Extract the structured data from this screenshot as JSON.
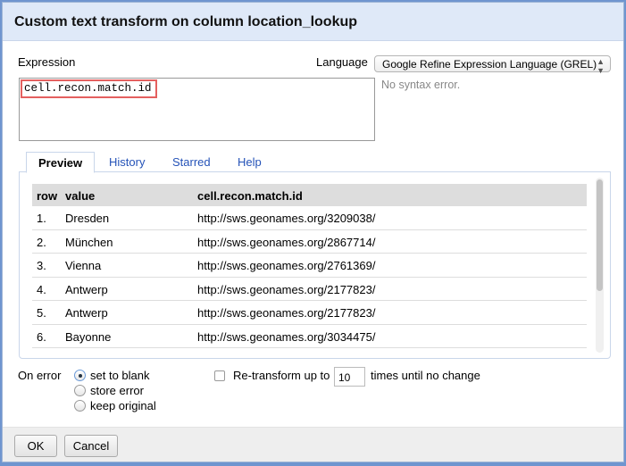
{
  "dialog": {
    "title": "Custom text transform on column location_lookup"
  },
  "expression": {
    "label": "Expression",
    "value": "cell.recon.match.id",
    "status": "No syntax error."
  },
  "language": {
    "label": "Language",
    "selected": "Google Refine Expression Language (GREL)"
  },
  "tabs": [
    {
      "label": "Preview",
      "active": true
    },
    {
      "label": "History"
    },
    {
      "label": "Starred"
    },
    {
      "label": "Help"
    }
  ],
  "preview": {
    "headers": [
      "row",
      "value",
      "cell.recon.match.id"
    ],
    "rows": [
      [
        "1.",
        "Dresden",
        "http://sws.geonames.org/3209038/"
      ],
      [
        "2.",
        "München",
        "http://sws.geonames.org/2867714/"
      ],
      [
        "3.",
        "Vienna",
        "http://sws.geonames.org/2761369/"
      ],
      [
        "4.",
        "Antwerp",
        "http://sws.geonames.org/2177823/"
      ],
      [
        "5.",
        "Antwerp",
        "http://sws.geonames.org/2177823/"
      ],
      [
        "6.",
        "Bayonne",
        "http://sws.geonames.org/3034475/"
      ]
    ]
  },
  "on_error": {
    "label": "On error",
    "options": [
      "set to blank",
      "store error",
      "keep original"
    ],
    "selected": "set to blank"
  },
  "retransform": {
    "checked": false,
    "label_before": "Re-transform up to",
    "value": "10",
    "label_after": "times until no change"
  },
  "buttons": {
    "ok": "OK",
    "cancel": "Cancel"
  },
  "colors": {
    "highlight": "#e4605f",
    "link": "#2553b8",
    "header_bg": "#dfe9f8"
  }
}
